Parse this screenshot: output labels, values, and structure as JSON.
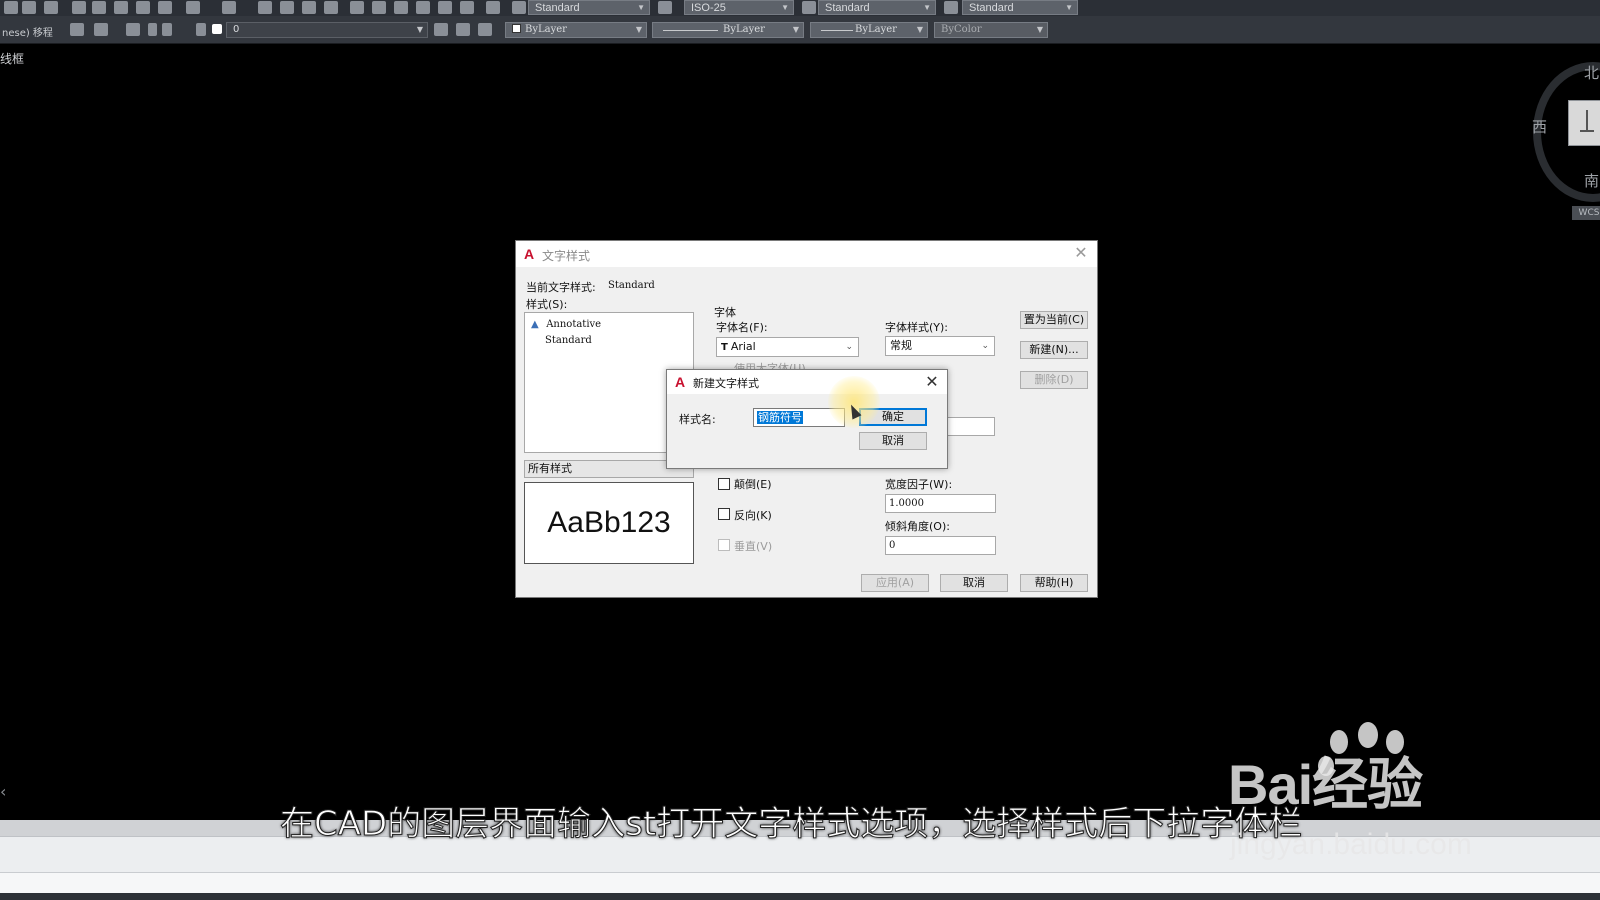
{
  "toolbar": {
    "text_style": "Standard",
    "dim_style": "ISO-25",
    "table_style": "Standard",
    "mleader_style": "Standard",
    "workspace_label": "nese) 移程",
    "layer_value": "0",
    "color": "ByLayer",
    "linetype": "ByLayer",
    "lineweight": "ByLayer",
    "plotstyle": "ByColor"
  },
  "viewport_label": "线框",
  "viewcube": {
    "north": "北",
    "west": "西",
    "south": "南",
    "wcs": "WCS"
  },
  "text_style_dialog": {
    "title": "文字样式",
    "current_style_label": "当前文字样式:",
    "current_style_value": "Standard",
    "styles_label": "样式(S):",
    "styles": [
      "Annotative",
      "Standard"
    ],
    "filter": "所有样式",
    "preview_text": "AaBb123",
    "font_group": "字体",
    "font_name_label": "字体名(F):",
    "font_name": "Arial",
    "font_style_label": "字体样式(Y):",
    "font_style": "常规",
    "use_big_font": "使用大字体(U)",
    "set_current": "置为当前(C)",
    "new": "新建(N)...",
    "delete": "删除(D)",
    "upside_down": "颠倒(E)",
    "backwards": "反向(K)",
    "vertical": "垂直(V)",
    "width_factor_label": "宽度因子(W):",
    "width_factor": "1.0000",
    "oblique_label": "倾斜角度(O):",
    "oblique": "0",
    "apply": "应用(A)",
    "cancel": "取消",
    "help": "帮助(H)"
  },
  "new_style_dialog": {
    "title": "新建文字样式",
    "name_label": "样式名:",
    "name_value": "钢筋符号",
    "ok": "确定",
    "cancel": "取消"
  },
  "subtitle": "在CAD的图层界面输入st打开文字样式选项，选择样式后下拉字体栏",
  "watermark": {
    "logo": "Bai经验",
    "url": "jingyan.baidu.com"
  },
  "colors": {
    "autocad_red": "#c8102e",
    "focus_blue": "#0078d7",
    "canvas": "#000000"
  }
}
